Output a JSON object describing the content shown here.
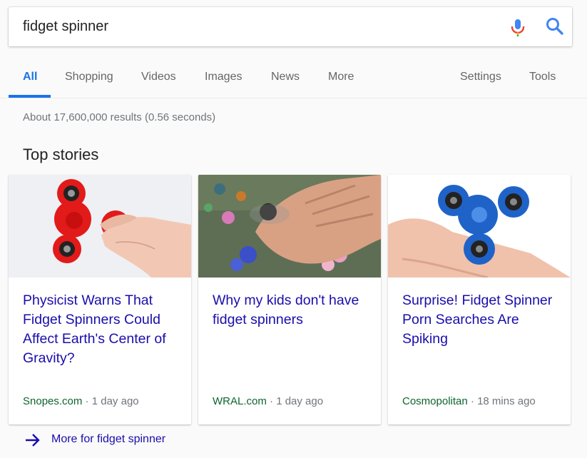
{
  "search": {
    "query": "fidget spinner"
  },
  "tabs": [
    "All",
    "Shopping",
    "Videos",
    "Images",
    "News",
    "More",
    "Settings",
    "Tools"
  ],
  "results": {
    "stats": "About 17,600,000 results (0.56 seconds)"
  },
  "top_stories": {
    "heading": "Top stories",
    "cards": [
      {
        "title": "Physicist Warns That Fidget Spinners Could Affect Earth's Center of Gravity?",
        "source": "Snopes.com",
        "time": "1 day ago"
      },
      {
        "title": "Why my kids don't have fidget spinners",
        "source": "WRAL.com",
        "time": "1 day ago"
      },
      {
        "title": "Surprise! Fidget Spinner Porn Searches Are Spiking",
        "source": "Cosmopolitan",
        "time": "18 mins ago"
      }
    ],
    "more_label": "More for fidget spinner"
  },
  "colors": {
    "accent": "#1a73e8",
    "link": "#1a0dab",
    "source": "#0d652d",
    "meta": "#70757a"
  },
  "icons": {
    "mic": "microphone-icon",
    "search": "search-icon",
    "more": "arrow-right-icon"
  }
}
